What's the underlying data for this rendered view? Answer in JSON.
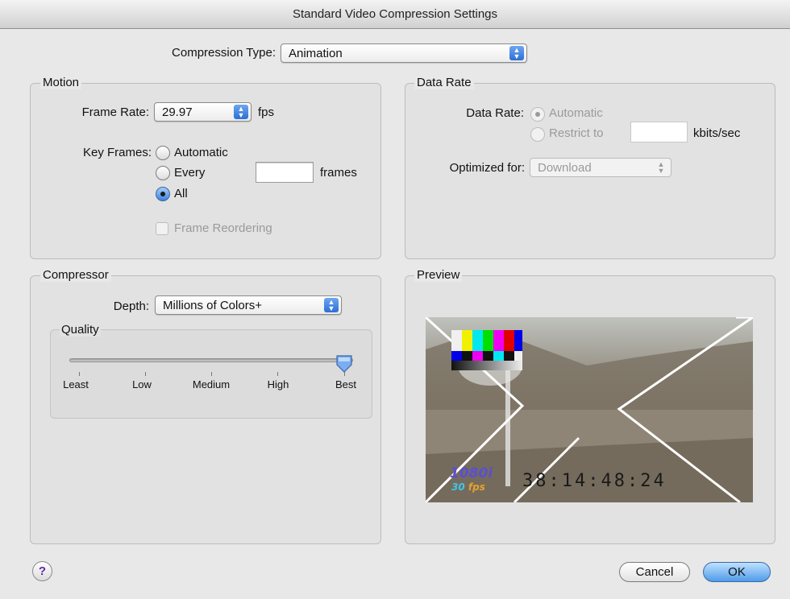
{
  "window": {
    "title": "Standard Video Compression Settings"
  },
  "compression": {
    "label": "Compression Type:",
    "value": "Animation"
  },
  "motion": {
    "title": "Motion",
    "frame_rate_label": "Frame Rate:",
    "frame_rate_value": "29.97",
    "fps_unit": "fps",
    "key_frames_label": "Key Frames:",
    "kf_automatic": "Automatic",
    "kf_every": "Every",
    "kf_every_value": "",
    "kf_frames_unit": "frames",
    "kf_all": "All",
    "kf_selected": "All",
    "frame_reordering": "Frame Reordering"
  },
  "data_rate": {
    "title": "Data Rate",
    "label": "Data Rate:",
    "automatic": "Automatic",
    "restrict": "Restrict to",
    "restrict_value": "",
    "unit": "kbits/sec",
    "optimized_label": "Optimized for:",
    "optimized_value": "Download"
  },
  "compressor": {
    "title": "Compressor",
    "depth_label": "Depth:",
    "depth_value": "Millions of Colors+",
    "quality_title": "Quality",
    "quality_level": 1.0,
    "quality_ticks": [
      "Least",
      "Low",
      "Medium",
      "High",
      "Best"
    ]
  },
  "preview": {
    "title": "Preview",
    "timecode": "38:14:48:24",
    "format_badge": "1080i",
    "fps_badge": "30",
    "fps_badge_unit": "fps"
  },
  "buttons": {
    "help": "?",
    "cancel": "Cancel",
    "ok": "OK"
  },
  "colors": {
    "accent": "#3b82e0",
    "default_button": "#4f9be9"
  }
}
